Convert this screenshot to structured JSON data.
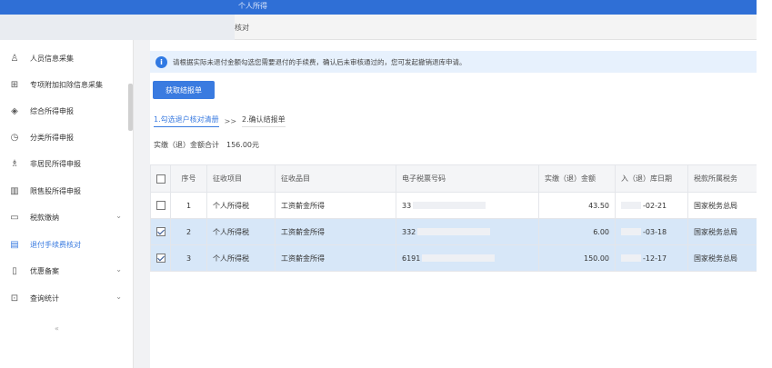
{
  "header": {
    "title": "个人所得",
    "breadcrumb": "核对"
  },
  "sidebar": {
    "items": [
      {
        "label": "人员信息采集",
        "icon": "user-icon",
        "glyph": "♙",
        "chevron": ""
      },
      {
        "label": "专项附加扣除信息采集",
        "icon": "grid-list-icon",
        "glyph": "⊞",
        "chevron": ""
      },
      {
        "label": "综合所得申报",
        "icon": "layers-icon",
        "glyph": "◈",
        "chevron": ""
      },
      {
        "label": "分类所得申报",
        "icon": "clock-icon",
        "glyph": "◷",
        "chevron": ""
      },
      {
        "label": "非居民所得申报",
        "icon": "person-icon",
        "glyph": "♗",
        "chevron": ""
      },
      {
        "label": "限售股所得申报",
        "icon": "bar-chart-icon",
        "glyph": "▥",
        "chevron": ""
      },
      {
        "label": "税款缴纳",
        "icon": "folder-icon",
        "glyph": "▭",
        "chevron": "⌄"
      },
      {
        "label": "退付手续费核对",
        "icon": "receipt-icon",
        "glyph": "▤",
        "chevron": ""
      },
      {
        "label": "优惠备案",
        "icon": "document-icon",
        "glyph": "▯",
        "chevron": "⌄"
      },
      {
        "label": "查询统计",
        "icon": "search-doc-icon",
        "glyph": "⊡",
        "chevron": "⌄"
      }
    ],
    "active_index": 7,
    "collapse_label": "«"
  },
  "notice": {
    "text": "请根据实际未退付金额勾选您需要退付的手续费，确认后未审核通过的，您可发起撤销退库申请。",
    "icon": "info-icon",
    "icon_glyph": "i"
  },
  "actions": {
    "fetch_label": "获取结报单"
  },
  "steps": {
    "step1": "1.勾选退户核对清册",
    "separator": ">>",
    "step2": "2.确认结报单"
  },
  "summary": {
    "label": "实缴（退）金额合计",
    "amount": "156.00元"
  },
  "table": {
    "headers": [
      "",
      "序号",
      "征收项目",
      "征收品目",
      "电子税票号码",
      "实缴（退）金额",
      "入（退）库日期",
      "税款所属税务"
    ],
    "rows": [
      {
        "checked": false,
        "selected": false,
        "no": "1",
        "item": "个人所得税",
        "category": "工资薪金所得",
        "ticket": "33",
        "amount": "43.50",
        "date": "-02-21",
        "authority": "国家税务总局"
      },
      {
        "checked": true,
        "selected": true,
        "no": "2",
        "item": "个人所得税",
        "category": "工资薪金所得",
        "ticket": "332",
        "amount": "6.00",
        "date": "-03-18",
        "authority": "国家税务总局"
      },
      {
        "checked": true,
        "selected": true,
        "no": "3",
        "item": "个人所得税",
        "category": "工资薪金所得",
        "ticket": "6191",
        "amount": "150.00",
        "date": "-12-17",
        "authority": "国家税务总局"
      }
    ]
  },
  "colors": {
    "primary": "#3a7be0",
    "header_bar": "#2f6fd6",
    "row_selected": "#d7e7f8",
    "notice_bg": "#e7f1fd"
  }
}
